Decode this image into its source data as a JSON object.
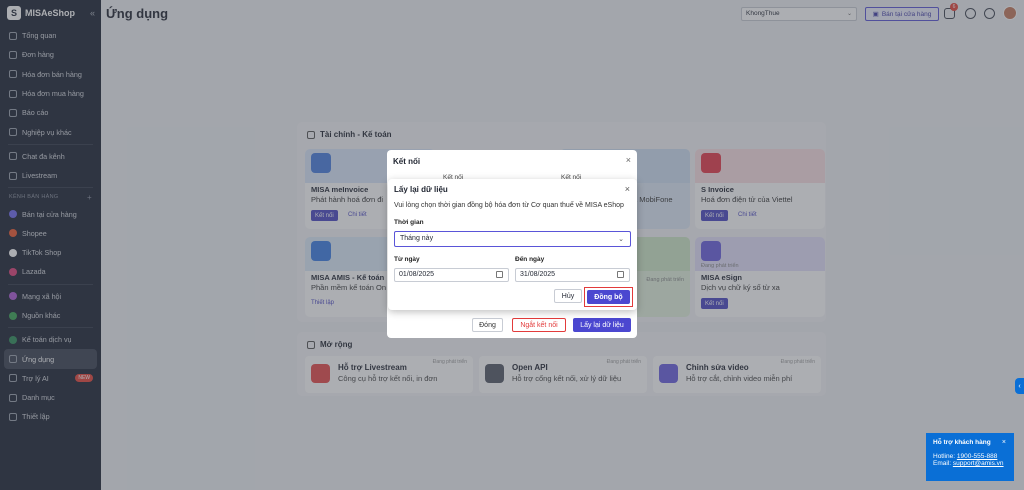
{
  "app": {
    "logo_text": "MISAeShop",
    "logo_letter": "S"
  },
  "sidebar": {
    "items_top": [
      {
        "label": "Tổng quan",
        "icon": "dashboard-icon"
      },
      {
        "label": "Đơn hàng",
        "icon": "order-icon"
      },
      {
        "label": "Hóa đơn bán hàng",
        "icon": "sales-invoice-icon"
      },
      {
        "label": "Hóa đơn mua hàng",
        "icon": "purchase-invoice-icon"
      },
      {
        "label": "Báo cáo",
        "icon": "report-icon"
      },
      {
        "label": "Nghiệp vụ khác",
        "icon": "grid-icon"
      },
      {
        "label": "Chat đa kênh",
        "icon": "chat-icon"
      },
      {
        "label": "Livestream",
        "icon": "livestream-icon"
      }
    ],
    "section_label": "KÊNH BÁN HÀNG",
    "channels": [
      {
        "label": "Bán tại cửa hàng",
        "color": "#6f6af0"
      },
      {
        "label": "Shopee",
        "color": "#f0582e"
      },
      {
        "label": "TikTok Shop",
        "color": "#222222"
      },
      {
        "label": "Lazada",
        "color": "#e0407a"
      }
    ],
    "items_bottom": [
      {
        "label": "Mạng xã hội",
        "color": "#b05ad8"
      },
      {
        "label": "Nguồn khác",
        "color": "#3aa655"
      },
      {
        "label": "Kế toán dịch vụ",
        "color": "#2f8f5a"
      },
      {
        "label": "Ứng dụng",
        "icon": "apps-icon"
      },
      {
        "label": "Trợ lý AI",
        "icon": "ai-icon",
        "badge": "NEW"
      },
      {
        "label": "Danh mục",
        "icon": "list-icon"
      },
      {
        "label": "Thiết lập",
        "icon": "settings-icon"
      }
    ]
  },
  "header": {
    "title": "Ứng dụng",
    "tenant": "KhongThue",
    "store_button": "Bán tại cửa hàng",
    "notif_count": "6"
  },
  "finance": {
    "title": "Tài chính - Kế toán",
    "cards": [
      {
        "name": "MISA meInvoice",
        "desc": "Phát hành hoá đơn đi",
        "connect": "Kết nối",
        "detail": "Chi tiết",
        "color": "#4a7fe0"
      },
      {
        "name": "S Invoice",
        "desc": "Hoá đơn điện tử của Viettel",
        "connect": "Kết nối",
        "detail": "Chi tiết",
        "color": "#e83a4a"
      },
      {
        "name": "MISA AMIS - Kế toán",
        "desc": "Phần mềm kế toán On",
        "detail": "Thiết lập",
        "color": "#3c7fe6"
      },
      {
        "name": "MISA eSign",
        "desc": "Dịch vụ chữ ký số từ xa",
        "connect": "Kết nối",
        "tag": "Đang phát triển",
        "color": "#6a5fe0"
      }
    ],
    "mobifone_text": "a MobiFone",
    "tag_dev": "Đang phát triển"
  },
  "extend": {
    "title": "Mở rộng",
    "cards": [
      {
        "name": "Hỗ trợ Livestream",
        "desc": "Công cụ hỗ trợ kết nối, in đơn",
        "tag": "Đang phát triển",
        "color": "#e84a4a"
      },
      {
        "name": "Open API",
        "desc": "Hỗ trợ cổng kết nối, xử lý dữ liệu",
        "tag": "Đang phát triển",
        "color": "#555a66"
      },
      {
        "name": "Chỉnh sửa video",
        "desc": "Hỗ trợ cắt, chỉnh video miễn phí",
        "tag": "Đang phát triển",
        "color": "#6a5fe0"
      }
    ]
  },
  "dialog_bg": {
    "title": "Kết nối",
    "partial_label": "Kết nối",
    "buttons": {
      "close": "Đóng",
      "disconnect": "Ngắt kết nối",
      "reload": "Lấy lại dữ liệu"
    }
  },
  "dialog": {
    "title": "Lấy lại dữ liệu",
    "description": "Vui lòng chọn thời gian đồng bộ hóa đơn từ Cơ quan thuế về MISA eShop",
    "period_label": "Thời gian",
    "period_value": "Tháng này",
    "from_label": "Từ ngày",
    "from_value": "01/08/2025",
    "to_label": "Đến ngày",
    "to_value": "31/08/2025",
    "cancel": "Hủy",
    "sync": "Đồng bộ"
  },
  "support": {
    "title": "Hỗ trợ khách hàng",
    "hotline_label": "Hotline:",
    "hotline": "1900-555-888",
    "email_label": "Email:",
    "email": "support@amis.vn"
  }
}
